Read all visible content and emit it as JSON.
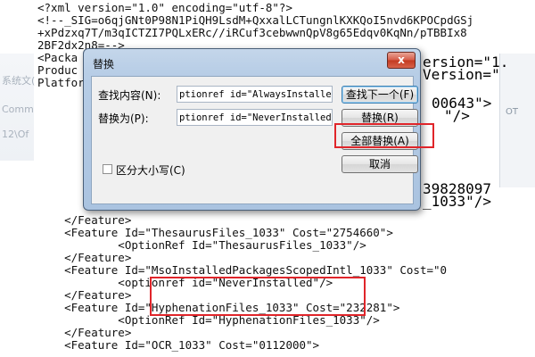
{
  "editor": {
    "lines": [
      "<?xml version=\"1.0\" encoding=\"utf-8\"?>",
      "<!--_SIG=o6qjGNt0P98N1PiQH9LsdM+QxxalLCTungnlKXKQoI5nvd6KPOCpdGSj",
      "+xPdzxq7T/m3qICTZI7PQLxERc//iRCuf3cebwwnQpV8g65Edqv0KqNn/pTBBIx8",
      "2BF2dx2n8=-->",
      "<Packa",
      "Produc",
      "Platfor",
      "",
      "",
      "",
      "",
      "",
      "",
      "",
      "",
      "",
      "",
      "    </Feature>",
      "    <Feature Id=\"ThesaurusFiles_1033\" Cost=\"2754660\">",
      "            <OptionRef Id=\"ThesaurusFiles_1033\"/>",
      "    </Feature>",
      "    <Feature Id=\"MsoInstalledPackagesScopedIntl_1033\" Cost=\"0",
      "            <optionref id=\"NeverInstalled\"/>",
      "    </Feature>",
      "    <Feature Id=\"HyphenationFiles_1033\" Cost=\"232281\">",
      "            <OptionRef Id=\"HyphenationFiles_1033\"/>",
      "    </Feature>",
      "    <Feature Id=\"OCR_1033\" Cost=\"0112000\">"
    ],
    "right_fragments": {
      "r1": "ersion=\"1.",
      "r2": "Version=\"",
      "r3": "00643\">",
      "r4": "\"/>",
      "r5": "39828097",
      "r6": "_1033\"/>"
    }
  },
  "left_strip": {
    "t1": "系统文(",
    "t2": "Comm",
    "t3": "12\\Of"
  },
  "right_panel": {
    "t1": "OT"
  },
  "dialog": {
    "title": "替换",
    "close_label": "x",
    "find_label": "查找内容(N):",
    "find_value": "ptionref id=\"AlwaysInstalled",
    "replace_label": "替换为(P):",
    "replace_value": "ptionref id=\"NeverInstalled",
    "find_next_label": "查找下一个(F)",
    "replace_btn_label": "替换(R)",
    "replace_all_label": "全部替换(A)",
    "cancel_label": "取消",
    "match_case_label": "区分大小写(C)"
  }
}
